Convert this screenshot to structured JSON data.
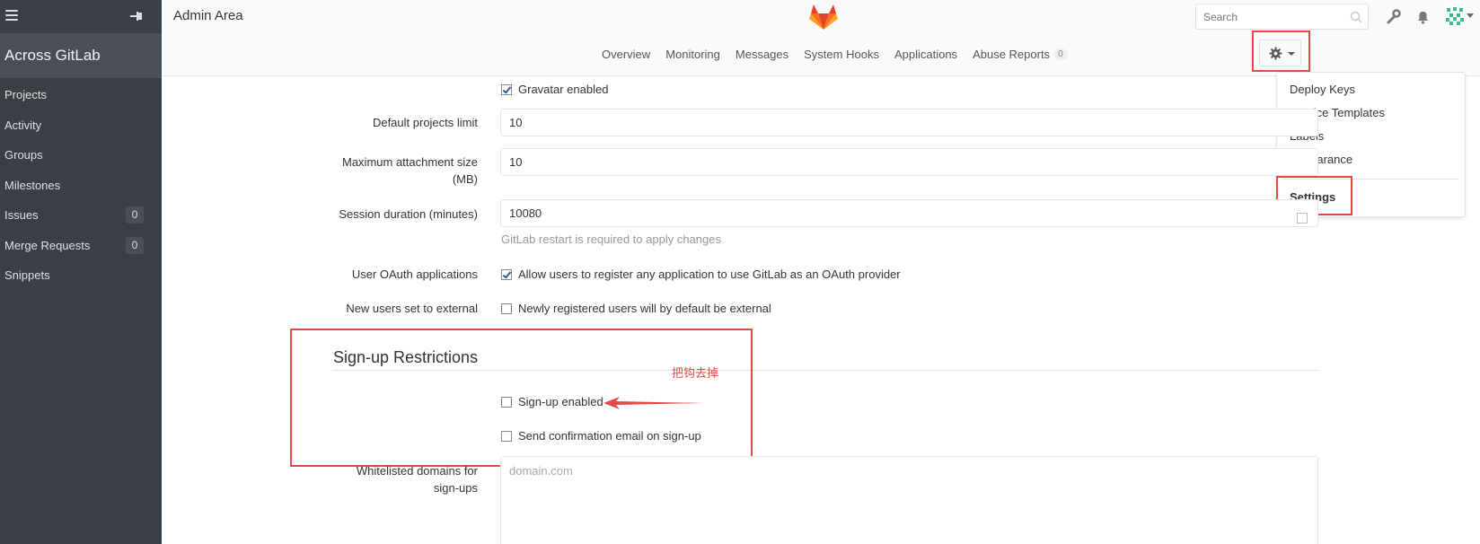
{
  "colors": {
    "sidebar": "#3a3e45",
    "accent_red": "#e34b46",
    "link": "#2a5da8"
  },
  "sidebar": {
    "group_title": "Across GitLab",
    "items": [
      {
        "label": "Projects",
        "count": ""
      },
      {
        "label": "Activity",
        "count": ""
      },
      {
        "label": "Groups",
        "count": ""
      },
      {
        "label": "Milestones",
        "count": ""
      },
      {
        "label": "Issues",
        "count": "0"
      },
      {
        "label": "Merge Requests",
        "count": "0"
      },
      {
        "label": "Snippets",
        "count": ""
      }
    ]
  },
  "header": {
    "title": "Admin Area",
    "search_placeholder": "Search"
  },
  "subnav": {
    "tabs": [
      {
        "label": "Overview"
      },
      {
        "label": "Monitoring"
      },
      {
        "label": "Messages"
      },
      {
        "label": "System Hooks"
      },
      {
        "label": "Applications"
      },
      {
        "label": "Abuse Reports",
        "badge": "0"
      }
    ]
  },
  "dropdown": {
    "items": [
      "Deploy Keys",
      "Service Templates",
      "Labels",
      "Appearance"
    ],
    "active": "Settings"
  },
  "form": {
    "gravatar_label": "Gravatar enabled",
    "default_projects_limit": {
      "label": "Default projects limit",
      "value": "10"
    },
    "max_attachment": {
      "label_line1": "Maximum attachment size",
      "label_line2": "(MB)",
      "value": "10"
    },
    "session_duration": {
      "label": "Session duration (minutes)",
      "value": "10080",
      "help": "GitLab restart is required to apply changes"
    },
    "oauth": {
      "label": "User OAuth applications",
      "checkbox": "Allow users to register any application to use GitLab as an OAuth provider"
    },
    "external": {
      "label": "New users set to external",
      "checkbox": "Newly registered users will by default be external"
    },
    "signup_section": {
      "title": "Sign-up Restrictions",
      "signup_enabled": "Sign-up enabled",
      "send_confirmation": "Send confirmation email on sign-up",
      "annotation": "把钩去掉"
    },
    "whitelist": {
      "label_line1": "Whitelisted domains for",
      "label_line2": "sign-ups",
      "placeholder": "domain.com"
    }
  }
}
